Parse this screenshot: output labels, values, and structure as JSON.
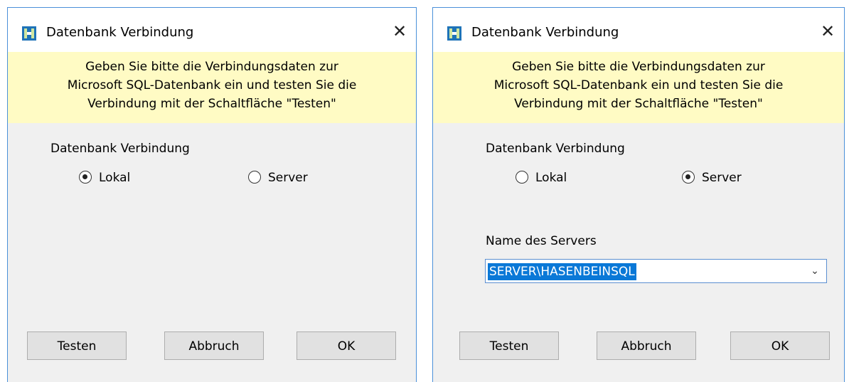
{
  "dialogs": [
    {
      "title": "Datenbank Verbindung",
      "close_glyph": "✕",
      "banner_lines": [
        "Geben Sie bitte die Verbindungsdaten zur",
        "Microsoft SQL-Datenbank ein und testen Sie die",
        "Verbindung mit der Schaltfläche \"Testen\""
      ],
      "group_label": "Datenbank Verbindung",
      "radio_local": {
        "label": "Lokal",
        "selected": true
      },
      "radio_server": {
        "label": "Server",
        "selected": false
      },
      "buttons": {
        "test": "Testen",
        "cancel": "Abbruch",
        "ok": "OK"
      }
    },
    {
      "title": "Datenbank Verbindung",
      "close_glyph": "✕",
      "banner_lines": [
        "Geben Sie bitte die Verbindungsdaten zur",
        "Microsoft SQL-Datenbank ein und testen Sie die",
        "Verbindung mit der Schaltfläche \"Testen\""
      ],
      "group_label": "Datenbank Verbindung",
      "radio_local": {
        "label": "Lokal",
        "selected": false
      },
      "radio_server": {
        "label": "Server",
        "selected": true
      },
      "server_name_label": "Name des Servers",
      "server_name_value": "SERVER\\HASENBEINSQL",
      "buttons": {
        "test": "Testen",
        "cancel": "Abbruch",
        "ok": "OK"
      }
    }
  ],
  "colors": {
    "banner_bg": "#fffbc4",
    "dialog_bg": "#f0f0f0",
    "window_border": "#4a90d9",
    "selection": "#0a78d7",
    "button_bg": "#e1e1e1"
  },
  "icons": {
    "app": "app-icon",
    "close": "close-icon",
    "dropdown": "chevron-down-icon"
  }
}
